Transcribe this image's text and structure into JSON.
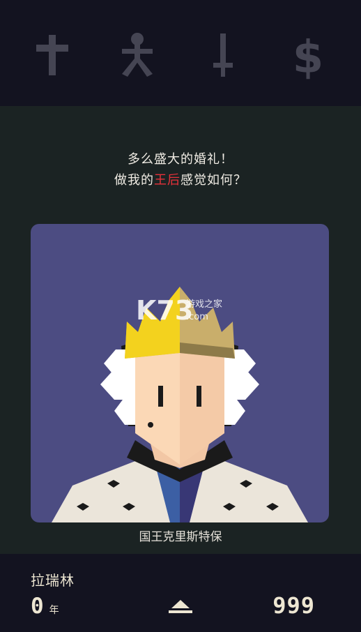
{
  "stats": [
    {
      "icon": "cross-icon",
      "label": "religion"
    },
    {
      "icon": "person-icon",
      "label": "people"
    },
    {
      "icon": "sword-icon",
      "label": "army"
    },
    {
      "icon": "dollar-icon",
      "label": "money"
    }
  ],
  "colors": {
    "topbar": "#131320",
    "main": "#1b2323",
    "card": "#4c4c82",
    "highlight": "#e8323a",
    "icon_dim": "#454553",
    "text": "#f0ece4"
  },
  "dialog": {
    "line1": "多么盛大的婚礼！",
    "line2_before": "做我的",
    "line2_highlight": "王后",
    "line2_after": "感觉如何？"
  },
  "character": {
    "name": "国王克里斯特保"
  },
  "watermark": {
    "brand": "K73",
    "site": "游戏之家",
    "domain": ".com"
  },
  "footer": {
    "ruler_name": "拉瑞林",
    "years": "0",
    "years_unit": "年",
    "total": "999"
  }
}
